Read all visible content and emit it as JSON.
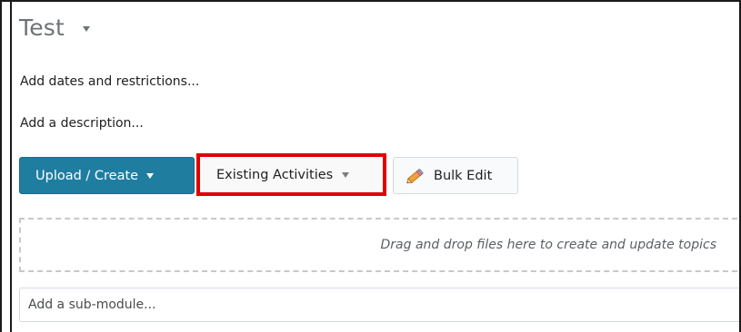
{
  "module": {
    "title": "Test"
  },
  "links": {
    "dates": "Add dates and restrictions...",
    "description": "Add a description..."
  },
  "toolbar": {
    "upload_label": "Upload / Create",
    "existing_label": "Existing Activities",
    "bulk_label": "Bulk Edit"
  },
  "dropzone": {
    "text": "Drag and drop files here to create and update topics"
  },
  "submodule": {
    "placeholder": "Add a sub-module..."
  },
  "colors": {
    "primary_button": "#1f7ea0",
    "highlight": "#e00000"
  },
  "icons": {
    "title_menu": "caret-down-icon",
    "bulk_edit": "pencil-icon"
  }
}
